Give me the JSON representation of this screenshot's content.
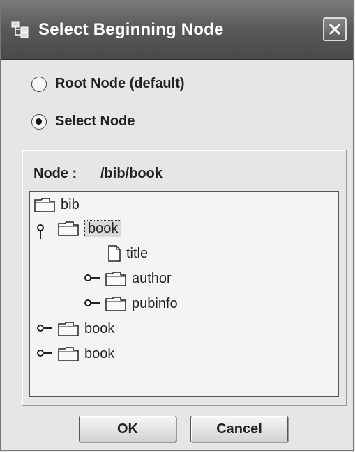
{
  "window": {
    "title": "Select Beginning Node",
    "title_icon": "tree-app-icon",
    "close_icon": "close-icon"
  },
  "options": [
    {
      "label": "Root Node (default)",
      "checked": false
    },
    {
      "label": "Select Node",
      "checked": true
    }
  ],
  "node": {
    "label": "Node :",
    "value": "/bib/book"
  },
  "tree": {
    "items": [
      {
        "label": "bib",
        "type": "folder",
        "toggle": "none"
      },
      {
        "label": "book",
        "type": "folder",
        "toggle": "expanded",
        "selected": true
      },
      {
        "label": "title",
        "type": "file",
        "toggle": "none"
      },
      {
        "label": "author",
        "type": "folder",
        "toggle": "collapsed"
      },
      {
        "label": "pubinfo",
        "type": "folder",
        "toggle": "collapsed"
      },
      {
        "label": "book",
        "type": "folder",
        "toggle": "collapsed"
      },
      {
        "label": "book",
        "type": "folder",
        "toggle": "collapsed"
      }
    ]
  },
  "buttons": {
    "ok": "OK",
    "cancel": "Cancel"
  }
}
